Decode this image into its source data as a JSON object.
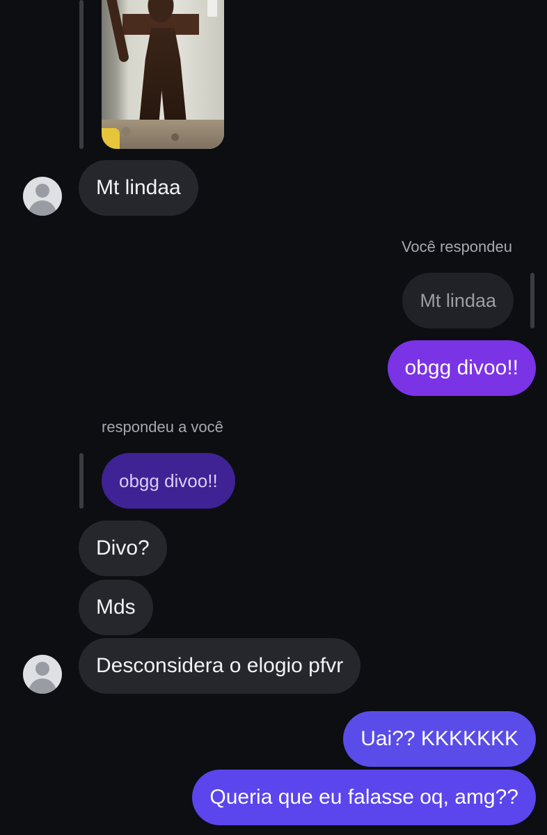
{
  "thread": {
    "reply_meta_you": "Você respondeu",
    "reply_meta_them": "respondeu a você"
  },
  "messages": {
    "m1": "Mt lindaa",
    "quote_you": "Mt lindaa",
    "m2": "obgg divoo!!",
    "quote_them": "obgg divoo!!",
    "m3": "Divo?",
    "m4": "Mds",
    "m5": "Desconsidera o elogio pfvr",
    "m6": "Uai?? KKKKKKK",
    "m7": "Queria que eu falasse oq, amg??"
  },
  "colors": {
    "background": "#0c0e12",
    "incoming_bubble": "#25272c",
    "outgoing_purple": "#7b33e6",
    "outgoing_indigo": "#5a4ce8",
    "quoted_purple": "#3f2294"
  }
}
